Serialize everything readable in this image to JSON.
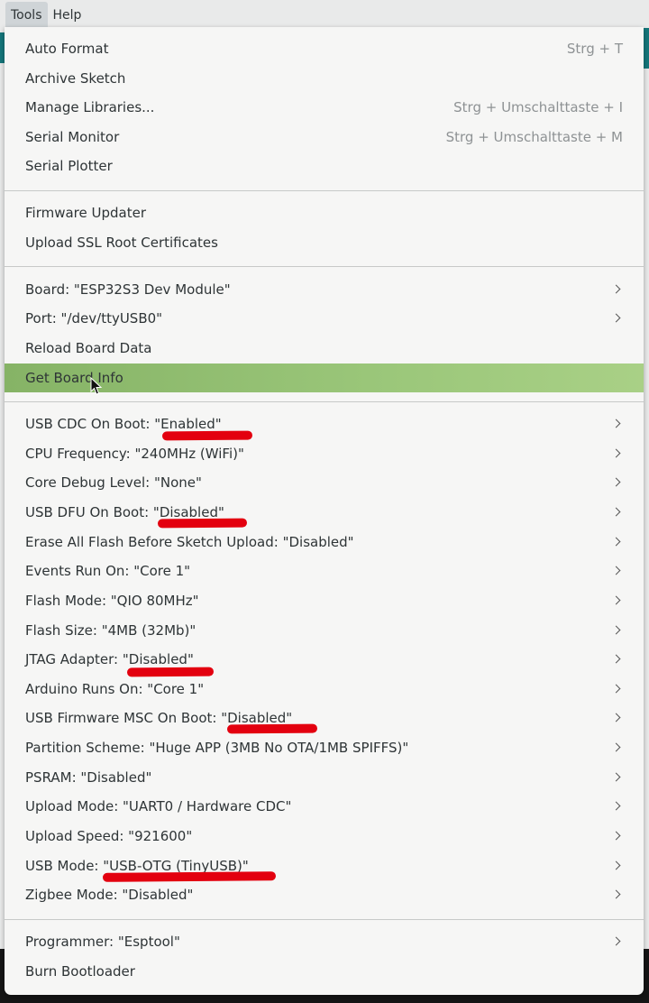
{
  "menubar": {
    "tools": "Tools",
    "help": "Help"
  },
  "menu": {
    "group1": [
      {
        "label": "Auto Format",
        "accel": "Strg + T"
      },
      {
        "label": "Archive Sketch",
        "accel": ""
      },
      {
        "label": "Manage Libraries...",
        "accel": "Strg + Umschalttaste + I"
      },
      {
        "label": "Serial Monitor",
        "accel": "Strg + Umschalttaste + M"
      },
      {
        "label": "Serial Plotter",
        "accel": ""
      }
    ],
    "group2": [
      {
        "label": "Firmware Updater"
      },
      {
        "label": "Upload SSL Root Certificates"
      }
    ],
    "group3": [
      {
        "label": "Board: \"ESP32S3 Dev Module\""
      },
      {
        "label": "Port: \"/dev/ttyUSB0\""
      },
      {
        "label": "Reload Board Data"
      },
      {
        "label": "Get Board Info"
      }
    ],
    "group4": [
      {
        "label": "USB CDC On Boot: \"Enabled\""
      },
      {
        "label": "CPU Frequency: \"240MHz (WiFi)\""
      },
      {
        "label": "Core Debug Level: \"None\""
      },
      {
        "label": "USB DFU On Boot: \"Disabled\""
      },
      {
        "label": "Erase All Flash Before Sketch Upload: \"Disabled\""
      },
      {
        "label": "Events Run On: \"Core 1\""
      },
      {
        "label": "Flash Mode: \"QIO 80MHz\""
      },
      {
        "label": "Flash Size: \"4MB (32Mb)\""
      },
      {
        "label": "JTAG Adapter: \"Disabled\""
      },
      {
        "label": "Arduino Runs On: \"Core 1\""
      },
      {
        "label": "USB Firmware MSC On Boot: \"Disabled\""
      },
      {
        "label": "Partition Scheme: \"Huge APP (3MB No OTA/1MB SPIFFS)\""
      },
      {
        "label": "PSRAM: \"Disabled\""
      },
      {
        "label": "Upload Mode: \"UART0 / Hardware CDC\""
      },
      {
        "label": "Upload Speed: \"921600\""
      },
      {
        "label": "USB Mode: \"USB-OTG (TinyUSB)\""
      },
      {
        "label": "Zigbee Mode: \"Disabled\""
      }
    ],
    "group5": [
      {
        "label": "Programmer: \"Esptool\""
      },
      {
        "label": "Burn Bootloader"
      }
    ]
  },
  "colors": {
    "highlight": "#9bc77a",
    "annotation": "#e3000f",
    "accent": "#14767a"
  }
}
